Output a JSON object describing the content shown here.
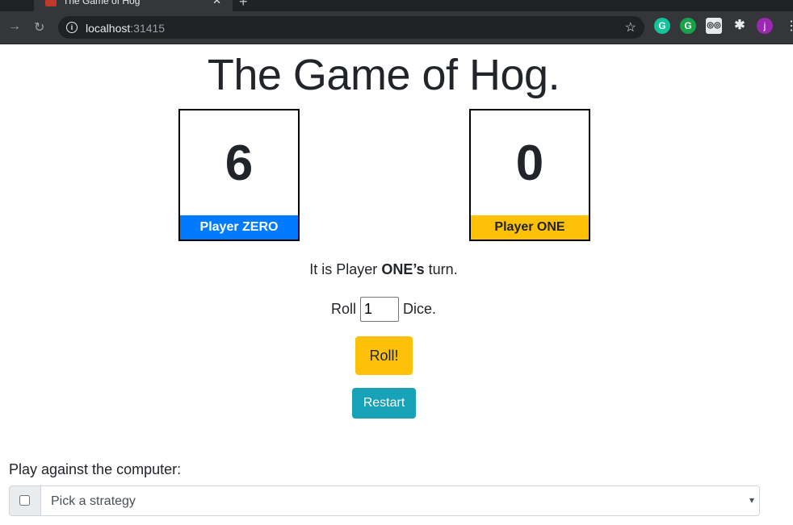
{
  "browser": {
    "tab_title": "The Game of Hog",
    "url_host": "localhost",
    "url_port": ":31415",
    "avatar_initial": "j",
    "ext_grammarly_1": "G",
    "ext_grammarly_2": "G"
  },
  "game": {
    "title_light": "The Game of ",
    "title_bold": "Hog",
    "title_suffix": ".",
    "players": [
      {
        "score": "6",
        "label": "Player ZERO"
      },
      {
        "score": "0",
        "label": "Player ONE"
      }
    ],
    "turn_prefix": "It is Player ",
    "turn_player": "ONE’s",
    "turn_suffix": " turn.",
    "roll_prefix": "Roll",
    "dice_value": "1",
    "roll_suffix": "Dice.",
    "roll_button": "Roll!",
    "restart_button": "Restart"
  },
  "computer": {
    "label": "Play against the computer:",
    "strategy_placeholder": "Pick a strategy",
    "checkbox_checked": false
  },
  "colors": {
    "player_zero": "#007bff",
    "player_one": "#ffc107",
    "restart": "#17a2b8"
  },
  "icons": [
    "back-arrow-icon",
    "reload-icon",
    "info-icon",
    "star-icon",
    "puzzle-icon",
    "more-menu-icon",
    "chevron-down-icon"
  ]
}
